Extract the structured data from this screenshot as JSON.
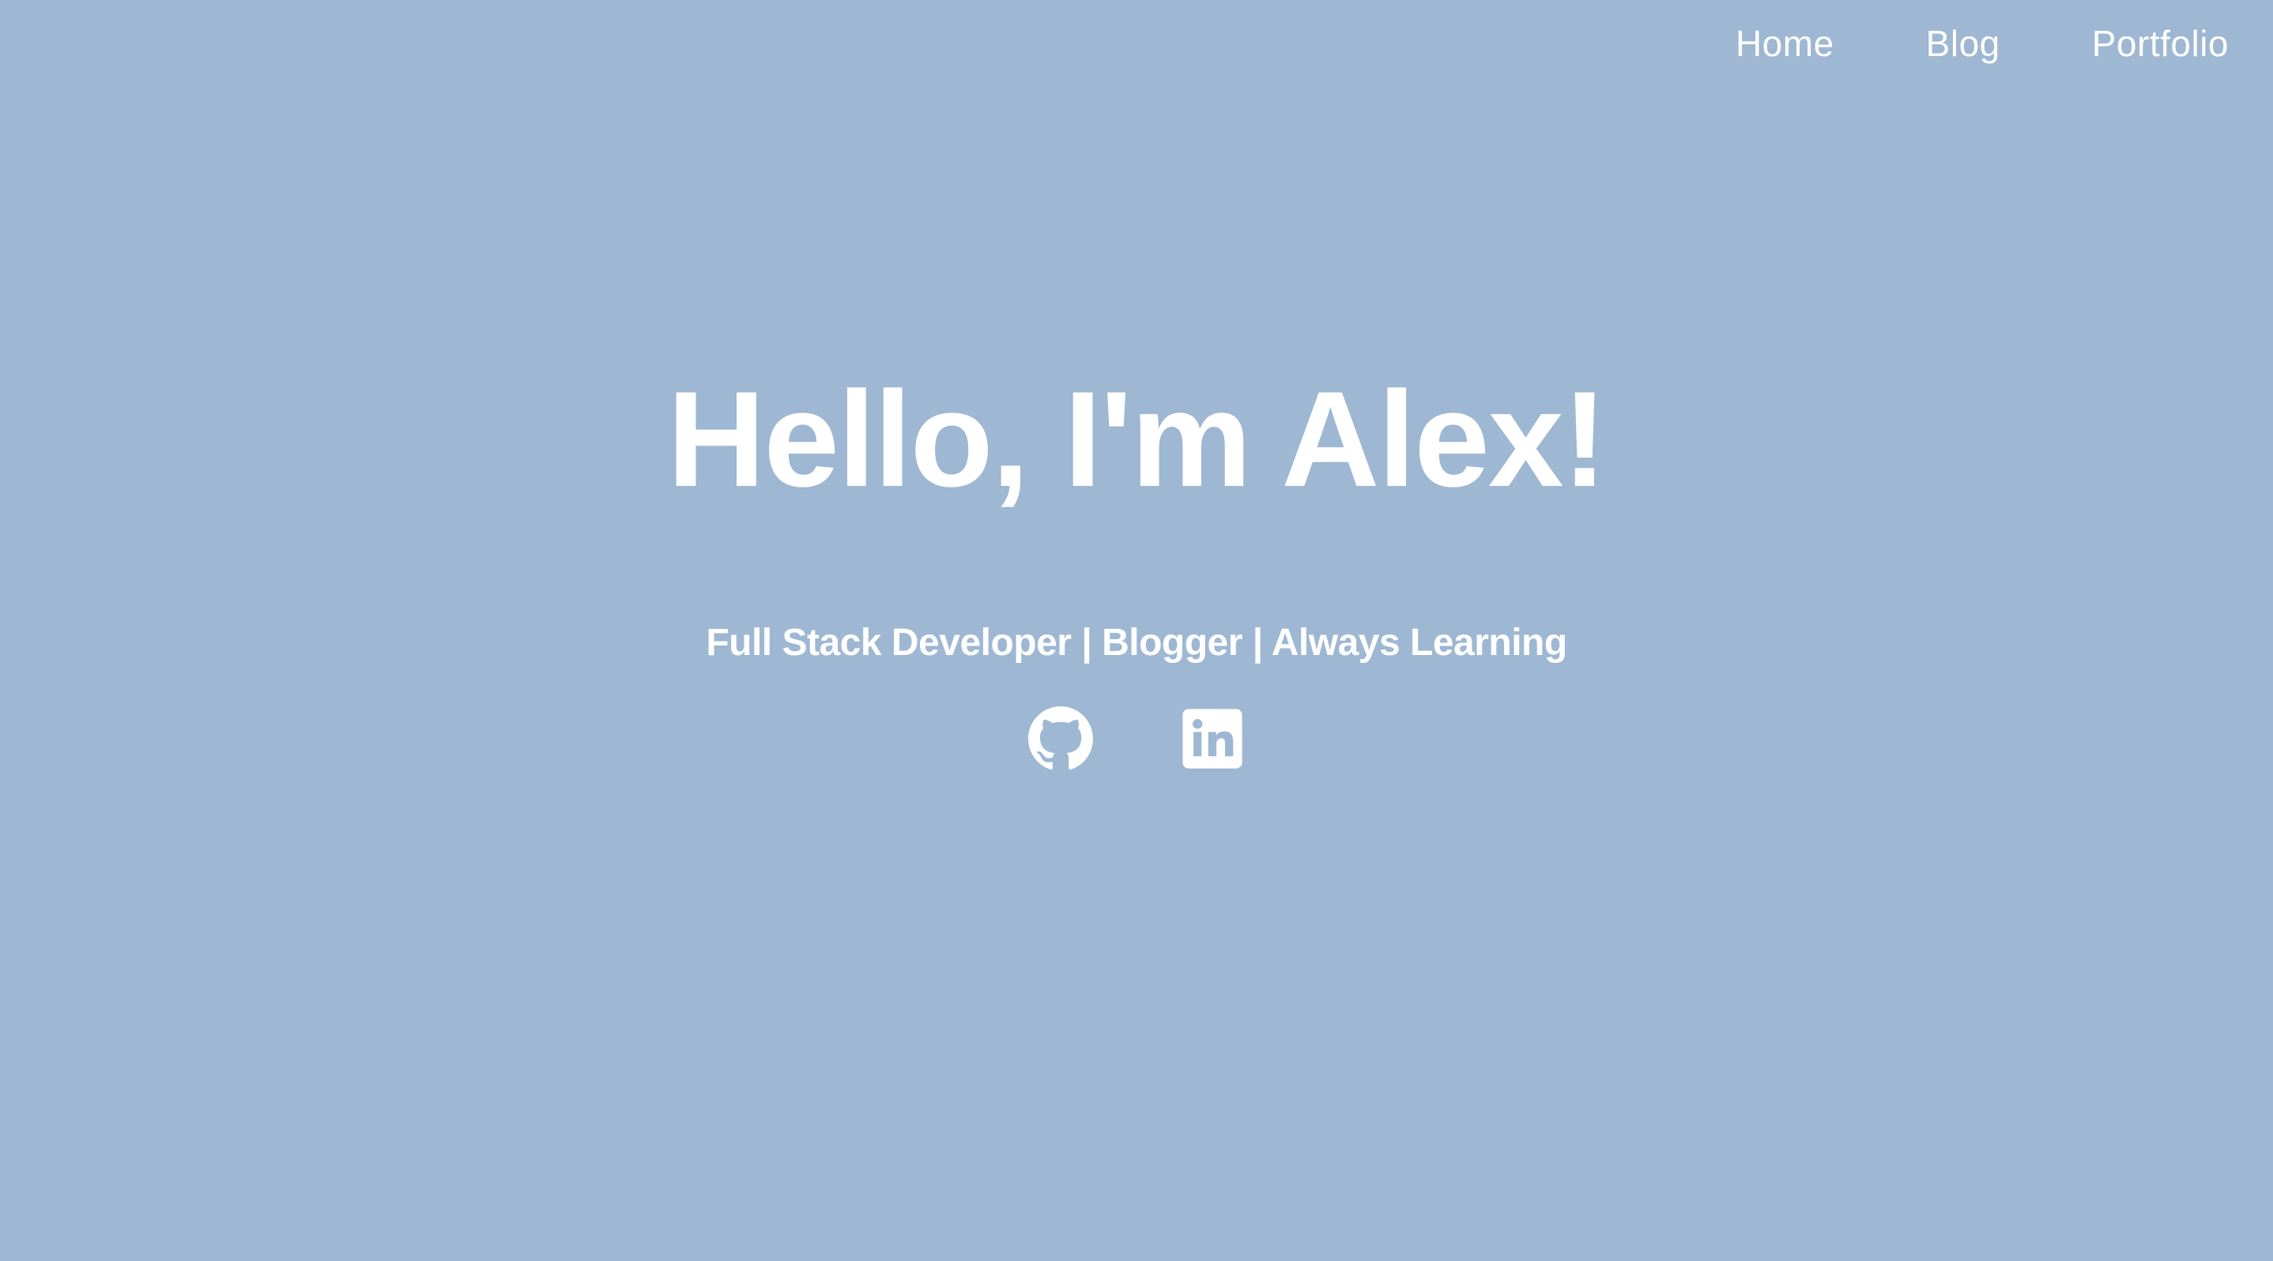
{
  "nav": {
    "items": [
      {
        "label": "Home"
      },
      {
        "label": "Blog"
      },
      {
        "label": "Portfolio"
      }
    ]
  },
  "hero": {
    "title": "Hello, I'm Alex!",
    "subtitle": "Full Stack Developer | Blogger | Always Learning"
  },
  "social": {
    "icons": [
      "github-icon",
      "linkedin-icon"
    ]
  },
  "colors": {
    "background": "#9eb7d3",
    "text": "#ffffff"
  }
}
